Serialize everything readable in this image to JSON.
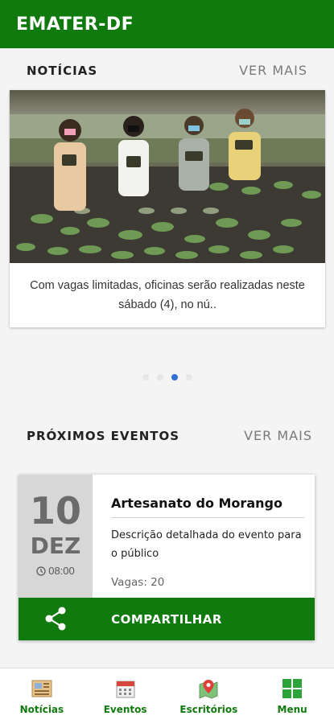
{
  "app": {
    "title": "EMATER-DF"
  },
  "news": {
    "title": "NOTÍCIAS",
    "more": "VER MAIS",
    "caption": "Com vagas limitadas, oficinas serão realizadas neste sábado (4), no nú..",
    "carousel": {
      "count": 4,
      "active_index": 2
    }
  },
  "events": {
    "title": "PRÓXIMOS EVENTOS",
    "more": "VER MAIS",
    "card": {
      "day": "10",
      "month": "DEZ",
      "time": "08:00",
      "title": "Artesanato do Morango",
      "description": "Descrição detalhada do evento para o público",
      "slots": "Vagas: 20",
      "share_label": "COMPARTILHAR"
    }
  },
  "nav": {
    "items": [
      {
        "label": "Notícias",
        "icon": "newspaper-icon"
      },
      {
        "label": "Eventos",
        "icon": "calendar-icon"
      },
      {
        "label": "Escritórios",
        "icon": "map-pin-icon"
      },
      {
        "label": "Menu",
        "icon": "grid-icon"
      }
    ]
  },
  "colors": {
    "primary": "#117a0e",
    "accent": "#2d6fd6",
    "date_bg": "#d7d7d7"
  }
}
